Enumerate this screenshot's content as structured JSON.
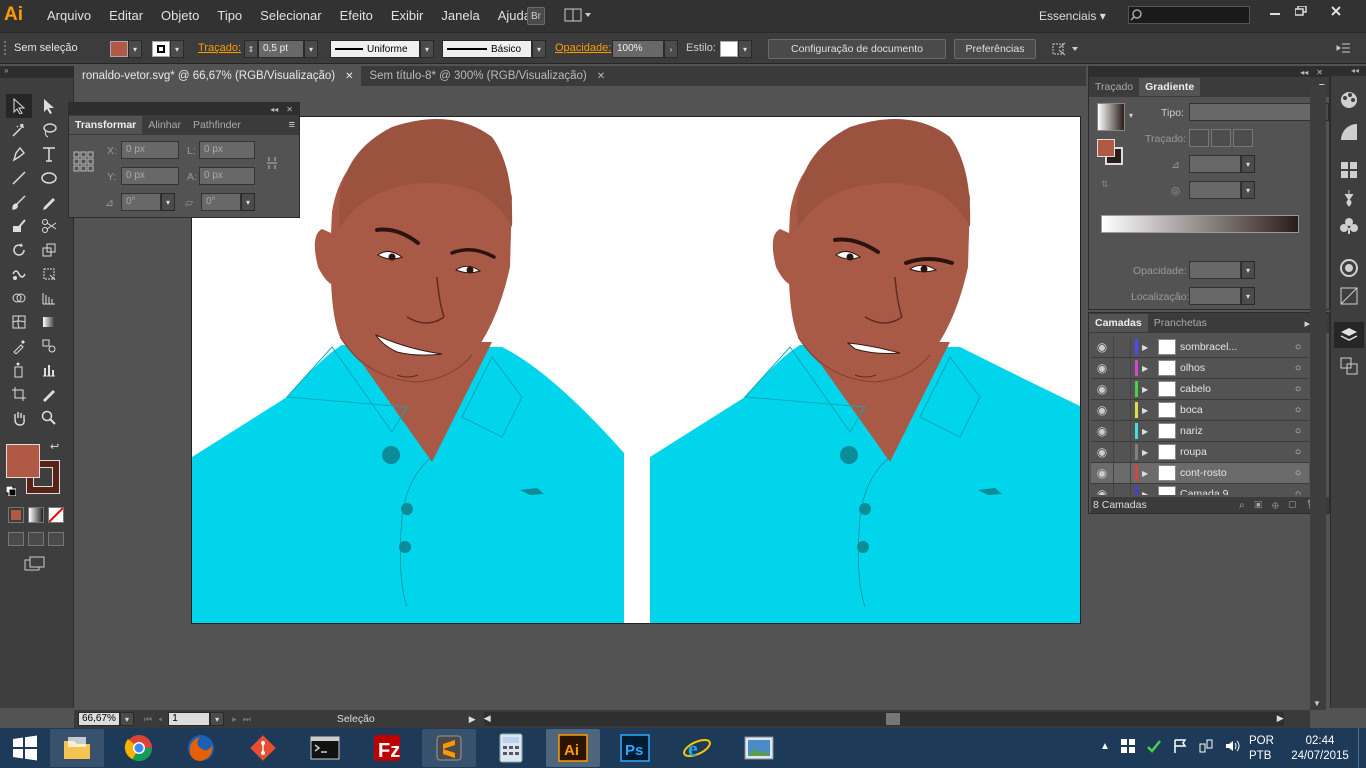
{
  "app": {
    "logo": "Ai"
  },
  "menu": [
    "Arquivo",
    "Editar",
    "Objeto",
    "Tipo",
    "Selecionar",
    "Efeito",
    "Exibir",
    "Janela",
    "Ajuda"
  ],
  "bridge_label": "Br",
  "workspace": "Essenciais",
  "search_placeholder": "",
  "control": {
    "selection_status": "Sem seleção",
    "fill_color": "#b05a45",
    "stroke_label": "Traçado:",
    "stroke_weight": "0,5 pt",
    "stroke_profile": "Uniforme",
    "brush": "Básico",
    "opacity_label": "Opacidade:",
    "opacity_value": "100%",
    "style_label": "Estilo:",
    "doc_setup_button": "Configuração de documento",
    "prefs_button": "Preferências"
  },
  "tabs": [
    {
      "label": "ronaldo-vetor.svg* @ 66,67% (RGB/Visualização)",
      "active": true
    },
    {
      "label": "Sem título-8* @ 300% (RGB/Visualização)",
      "active": false
    }
  ],
  "transform_panel": {
    "tabs": [
      "Transformar",
      "Alinhar",
      "Pathfinder"
    ],
    "x_label": "X:",
    "x": "0 px",
    "w_label": "L:",
    "w": "0 px",
    "y_label": "Y:",
    "y": "0 px",
    "h_label": "A:",
    "h": "0 px",
    "rotate": "0°",
    "shear": "0°"
  },
  "gradient_panel": {
    "tabs": [
      "Traçado",
      "Gradiente"
    ],
    "type_label": "Tipo:",
    "stroke_label": "Traçado:",
    "opacity_label": "Opacidade:",
    "location_label": "Localização:"
  },
  "layers_panel": {
    "tabs": [
      "Camadas",
      "Pranchetas"
    ],
    "layers": [
      {
        "name": "sombracel...",
        "color": "#4a4aff"
      },
      {
        "name": "olhos",
        "color": "#d04ad0"
      },
      {
        "name": "cabelo",
        "color": "#4ad04a"
      },
      {
        "name": "boca",
        "color": "#e0e040"
      },
      {
        "name": "nariz",
        "color": "#40e0e0"
      },
      {
        "name": "roupa",
        "color": "#808080"
      },
      {
        "name": "cont-rosto",
        "color": "#e04040"
      },
      {
        "name": "Camada 9",
        "color": "#4040e0"
      }
    ],
    "selected_layer": "cont-rosto",
    "count_label": "8 Camadas"
  },
  "status": {
    "zoom": "66,67%",
    "page": "1",
    "tool": "Seleção"
  },
  "colors": {
    "skin": "#a85a46",
    "hair": "#9b5340",
    "shirt": "#00d5ec",
    "button": "#0c8c98",
    "accent": "#ff9a00"
  },
  "taskbar": {
    "lang1": "POR",
    "lang2": "PTB",
    "time": "02:44",
    "date": "24/07/2015",
    "apps": [
      "file-explorer",
      "chrome",
      "firefox",
      "git",
      "cmd",
      "filezilla",
      "sublime",
      "calculator",
      "illustrator",
      "photoshop",
      "ie",
      "photo-viewer"
    ]
  }
}
